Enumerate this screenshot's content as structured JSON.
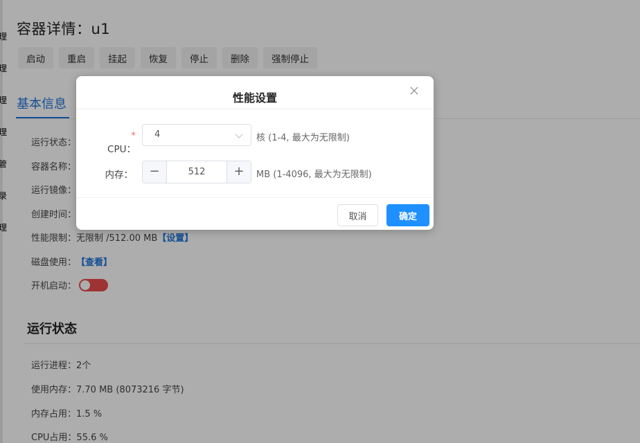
{
  "page": {
    "title": "容器详情：u1",
    "actions": [
      "启动",
      "重启",
      "挂起",
      "恢复",
      "停止",
      "删除",
      "强制停止"
    ],
    "tab": "基本信息",
    "edge_chars": [
      "理",
      "理",
      "理",
      "理",
      "管",
      "录",
      "理"
    ],
    "info": {
      "run_status_label": "运行状态：",
      "name_label": "容器名称：",
      "image_label": "运行镜像：",
      "created_label": "创建时间：",
      "perf_label": "性能限制：",
      "perf_value": "无限制 /512.00 MB",
      "perf_link": "【设置】",
      "disk_label": "磁盘使用：",
      "disk_link": "【查看】",
      "autostart_label": "开机启动："
    },
    "runtime": {
      "title": "运行状态",
      "processes": "运行进程：2个",
      "memory_used": "使用内存：7.70 MB (8073216 字节)",
      "memory_pct": "内存占用：1.5 %",
      "cpu_pct": "CPU占用：55.6 %"
    }
  },
  "dialog": {
    "title": "性能设置",
    "close_icon": "close-icon",
    "cpu_required_mark": "*",
    "cpu_label": "CPU：",
    "cpu_value": "4",
    "cpu_hint": "核 (1-4, 最大为无限制)",
    "mem_label": "内存：",
    "mem_value": "512",
    "mem_minus": "−",
    "mem_plus": "+",
    "mem_hint": "MB (1-4096, 最大为无限制)",
    "cancel": "取消",
    "confirm": "确定"
  },
  "colors": {
    "accent": "#1e90ff",
    "link": "#1f75d8",
    "toggle_off": "#e74c4c",
    "required": "#f56c6c"
  }
}
